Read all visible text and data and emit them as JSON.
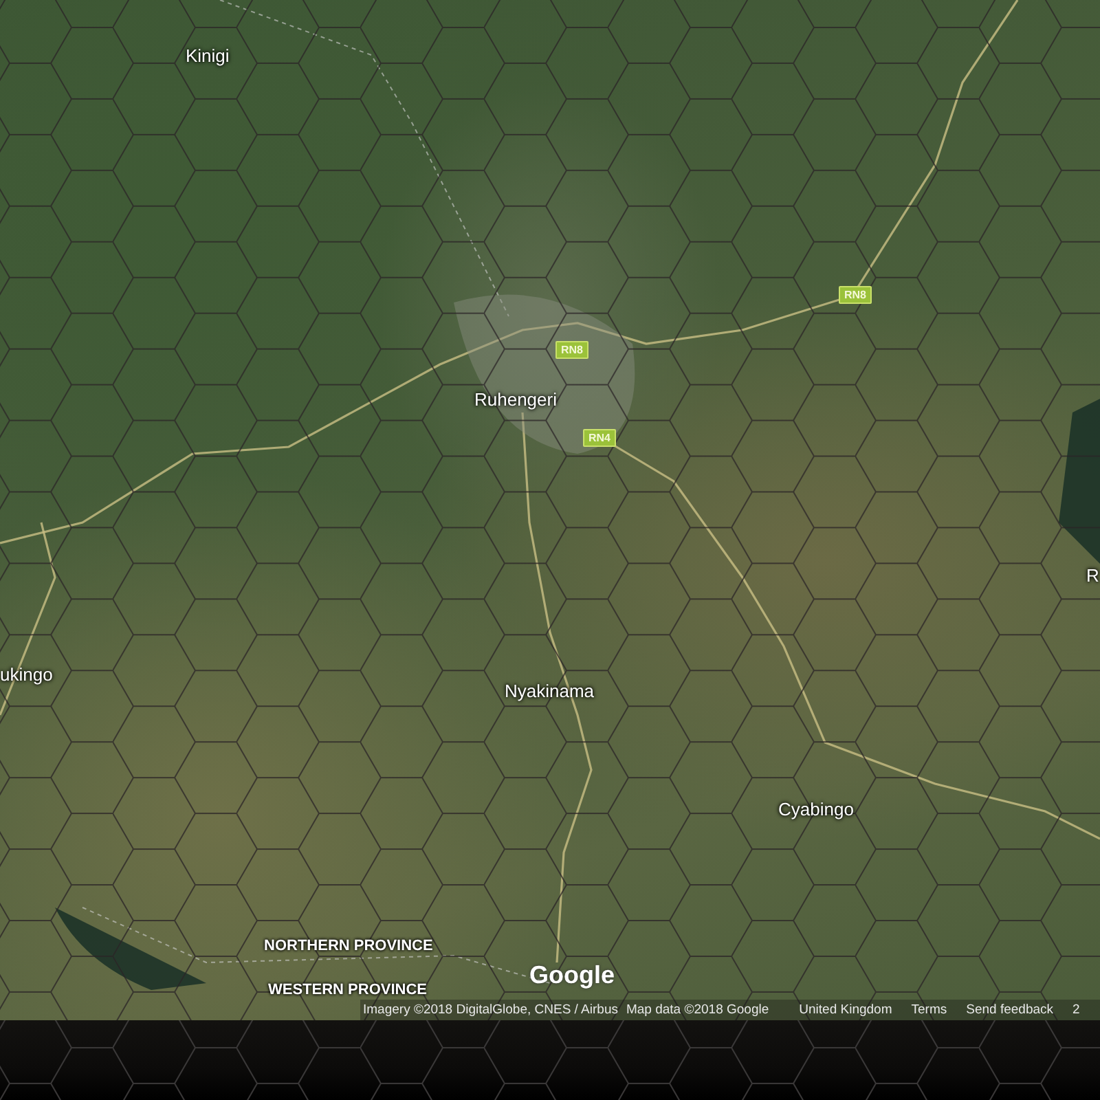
{
  "map": {
    "places": [
      {
        "name": "Kinigi"
      },
      {
        "name": "Ruhengeri"
      },
      {
        "name": "ukingo"
      },
      {
        "name": "Nyakinama"
      },
      {
        "name": "Cyabingo"
      },
      {
        "name": "R"
      }
    ],
    "road_shields": [
      {
        "label": "RN8"
      },
      {
        "label": "RN4"
      },
      {
        "label": "RN8"
      }
    ],
    "region_labels": [
      {
        "label": "NORTHERN PROVINCE"
      },
      {
        "label": "WESTERN PROVINCE"
      }
    ],
    "logo": "Google"
  },
  "attribution": [
    "Imagery ©2018 DigitalGlobe, CNES / Airbus",
    "Map data ©2018 Google",
    "United Kingdom",
    "Terms",
    "Send feedback",
    "2"
  ]
}
